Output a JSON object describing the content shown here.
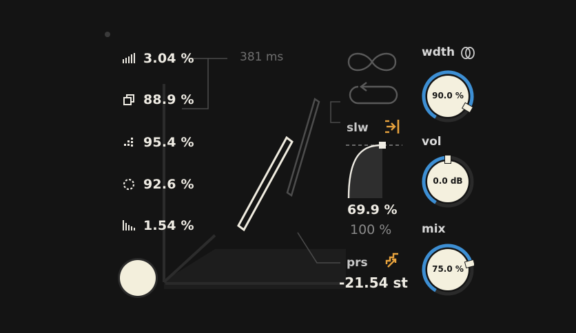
{
  "params": [
    {
      "id": "density",
      "icon": "bars-rising-icon",
      "value": "3.04 %"
    },
    {
      "id": "overlap",
      "icon": "stacked-squares-icon",
      "value": "88.9 %"
    },
    {
      "id": "scatter",
      "icon": "pixel-scatter-icon",
      "value": "95.4 %"
    },
    {
      "id": "spin",
      "icon": "dotted-circle-icon",
      "value": "92.6 %"
    },
    {
      "id": "spread",
      "icon": "bars-falling-icon",
      "value": "1.54 %"
    }
  ],
  "time_readout": "381 ms",
  "modes": {
    "loop_icon": "infinity-icon",
    "oneshot_icon": "loop-arrow-icon"
  },
  "slew": {
    "label": "slw",
    "icon": "arrow-to-bar-icon",
    "primary": "69.9 %",
    "secondary": "100 %"
  },
  "pitch": {
    "label": "prs",
    "icon": "stairs-arrow-icon",
    "value": "-21.54 st"
  },
  "knobs": [
    {
      "id": "wdth",
      "label": "wdth",
      "value": "90.0 %",
      "level": 0.9,
      "icon": "stereo-rings-icon"
    },
    {
      "id": "vol",
      "label": "vol",
      "value": "0.0 dB",
      "level": 0.5
    },
    {
      "id": "mix",
      "label": "mix",
      "value": "75.0 %",
      "level": 0.75
    }
  ],
  "colors": {
    "accent": "#e8a33d",
    "knob_arc": "#3d8fd4",
    "knob_face": "#f4f0de",
    "background": "#141414"
  }
}
